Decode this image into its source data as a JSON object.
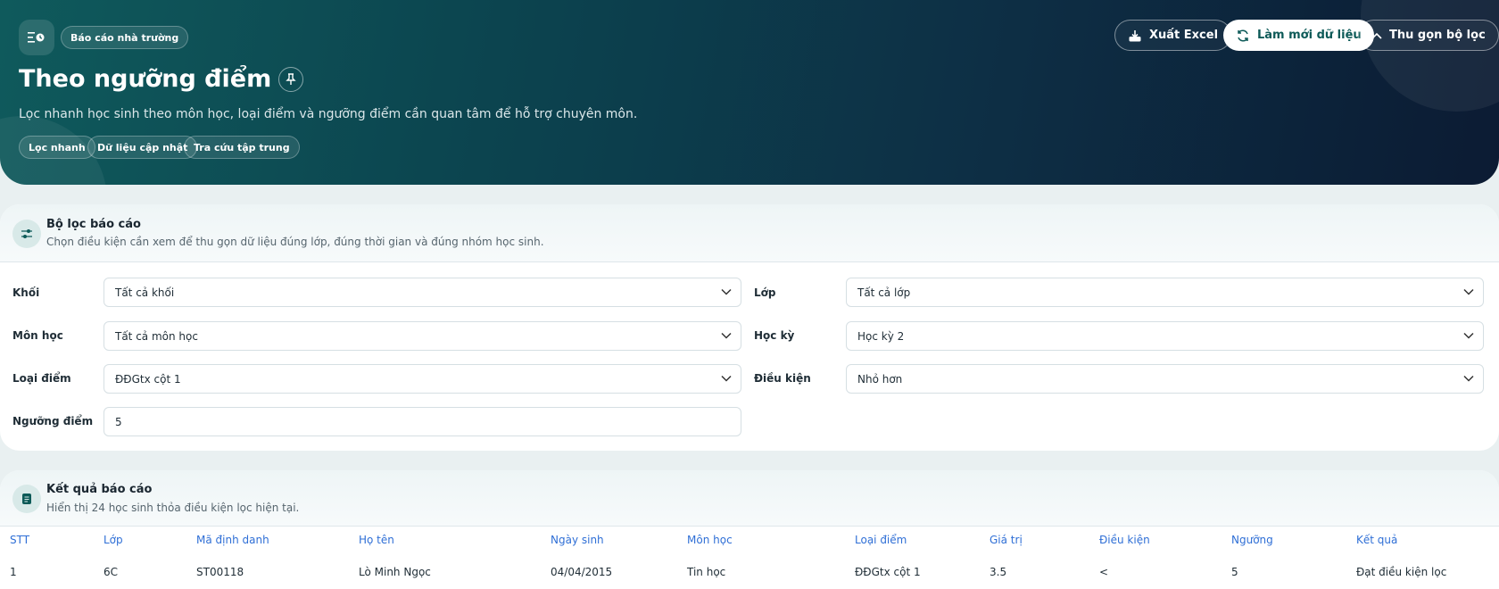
{
  "hero": {
    "badge": "Báo cáo nhà trường",
    "title": "Theo ngưỡng điểm",
    "description": "Lọc nhanh học sinh theo môn học, loại điểm và ngưỡng điểm cần quan tâm để hỗ trợ chuyên môn.",
    "tags": [
      "Lọc nhanh",
      "Dữ liệu cập nhật",
      "Tra cứu tập trung"
    ],
    "actions": {
      "export": "Xuất Excel",
      "refresh": "Làm mới dữ liệu",
      "collapse": "Thu gọn bộ lọc"
    }
  },
  "filters": {
    "title": "Bộ lọc báo cáo",
    "subtitle": "Chọn điều kiện cần xem để thu gọn dữ liệu đúng lớp, đúng thời gian và đúng nhóm học sinh.",
    "grade_label": "Khối",
    "grade_value": "Tất cả khối",
    "class_label": "Lớp",
    "class_value": "Tất cả lớp",
    "subject_label": "Môn học",
    "subject_value": "Tất cả môn học",
    "term_label": "Học kỳ",
    "term_value": "Học kỳ 2",
    "score_type_label": "Loại điểm",
    "score_type_value": "ĐĐGtx cột 1",
    "condition_label": "Điều kiện",
    "condition_value": "Nhỏ hơn",
    "threshold_label": "Ngưỡng điểm",
    "threshold_value": "5"
  },
  "results": {
    "title": "Kết quả báo cáo",
    "subtitle": "Hiển thị 24 học sinh thỏa điều kiện lọc hiện tại.",
    "columns": [
      "STT",
      "Lớp",
      "Mã định danh",
      "Họ tên",
      "Ngày sinh",
      "Môn học",
      "Loại điểm",
      "Giá trị",
      "Điều kiện",
      "Ngưỡng",
      "Kết quả"
    ],
    "rows": [
      [
        "1",
        "6C",
        "ST00118",
        "Lò Minh Ngọc",
        "04/04/2015",
        "Tin học",
        "ĐĐGtx cột 1",
        "3.5",
        "<",
        "5",
        "Đạt điều kiện lọc"
      ]
    ]
  },
  "colors": {
    "accent": "#0d5a58",
    "header_link": "#2f6fd6",
    "hero_dark": "#0c1b33"
  }
}
